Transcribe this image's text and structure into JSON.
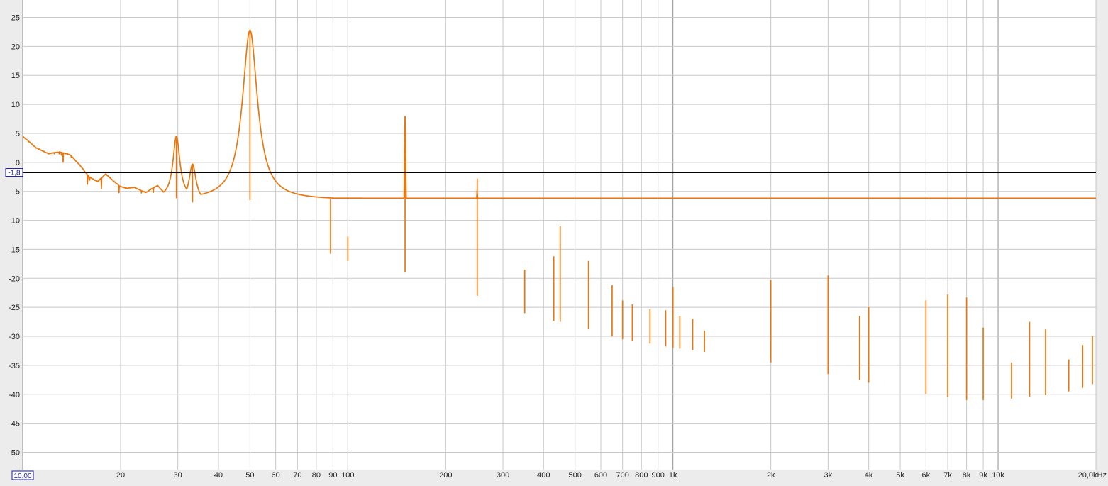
{
  "chart_data": {
    "type": "line",
    "x_scale": "log",
    "xlim": [
      10,
      20000
    ],
    "ylim": [
      -53,
      28
    ],
    "grid": true,
    "x_ticks": [
      {
        "value": 10,
        "label": "10,00",
        "boxed": true
      },
      {
        "value": 20,
        "label": "20"
      },
      {
        "value": 30,
        "label": "30"
      },
      {
        "value": 40,
        "label": "40"
      },
      {
        "value": 50,
        "label": "50"
      },
      {
        "value": 60,
        "label": "60"
      },
      {
        "value": 70,
        "label": "70"
      },
      {
        "value": 80,
        "label": "80"
      },
      {
        "value": 90,
        "label": "90"
      },
      {
        "value": 100,
        "label": "100"
      },
      {
        "value": 200,
        "label": "200"
      },
      {
        "value": 300,
        "label": "300"
      },
      {
        "value": 400,
        "label": "400"
      },
      {
        "value": 500,
        "label": "500"
      },
      {
        "value": 600,
        "label": "600"
      },
      {
        "value": 700,
        "label": "700"
      },
      {
        "value": 800,
        "label": "800"
      },
      {
        "value": 900,
        "label": "900"
      },
      {
        "value": 1000,
        "label": "1k"
      },
      {
        "value": 2000,
        "label": "2k"
      },
      {
        "value": 3000,
        "label": "3k"
      },
      {
        "value": 4000,
        "label": "4k"
      },
      {
        "value": 5000,
        "label": "5k"
      },
      {
        "value": 6000,
        "label": "6k"
      },
      {
        "value": 7000,
        "label": "7k"
      },
      {
        "value": 8000,
        "label": "8k"
      },
      {
        "value": 9000,
        "label": "9k"
      },
      {
        "value": 10000,
        "label": "10k"
      },
      {
        "value": 20000,
        "label": "20,0kHz"
      }
    ],
    "y_ticks": [
      {
        "value": 25,
        "label": "25"
      },
      {
        "value": 20,
        "label": "20"
      },
      {
        "value": 15,
        "label": "15"
      },
      {
        "value": 10,
        "label": "10"
      },
      {
        "value": 5,
        "label": "5"
      },
      {
        "value": 0,
        "label": "0"
      },
      {
        "value": -5,
        "label": "-5"
      },
      {
        "value": -10,
        "label": "-10"
      },
      {
        "value": -15,
        "label": "-15"
      },
      {
        "value": -20,
        "label": "-20"
      },
      {
        "value": -25,
        "label": "-25"
      },
      {
        "value": -30,
        "label": "-30"
      },
      {
        "value": -35,
        "label": "-35"
      },
      {
        "value": -40,
        "label": "-40"
      },
      {
        "value": -45,
        "label": "-45"
      },
      {
        "value": -50,
        "label": "-50"
      }
    ],
    "reference_line": {
      "value": -1.8,
      "label": "-1,8"
    },
    "colors": {
      "background": "#ffffff",
      "grid": "#c8c8c8",
      "grid_decade": "#909090",
      "trace": "#e8780e",
      "reference": "#000000",
      "tick_text": "#222222",
      "marker_text": "#1a1aa6"
    },
    "series": [
      {
        "noise_amplitude": 1.6,
        "floor": [
          [
            10,
            4.5
          ],
          [
            11,
            2.5
          ],
          [
            12,
            1.5
          ],
          [
            13,
            1.8
          ],
          [
            14,
            1.3
          ],
          [
            15,
            -0.5
          ],
          [
            16,
            -2.5
          ],
          [
            17,
            -3.3
          ],
          [
            18,
            -2.0
          ],
          [
            19,
            -3.2
          ],
          [
            20,
            -4.2
          ],
          [
            21,
            -4.5
          ],
          [
            22,
            -4.3
          ],
          [
            23,
            -4.8
          ],
          [
            24,
            -5.2
          ],
          [
            25,
            -4.5
          ],
          [
            26,
            -4.0
          ],
          [
            27,
            -5.0
          ],
          [
            28,
            -6.0
          ],
          [
            29,
            -6.6
          ],
          [
            30,
            -6.0
          ],
          [
            31,
            -5.1
          ],
          [
            32,
            -6.2
          ],
          [
            33,
            -7.1
          ],
          [
            34,
            -6.5
          ],
          [
            35,
            -6.2
          ],
          [
            36,
            -6.8
          ],
          [
            37,
            -7.5
          ],
          [
            37.5,
            -7.2
          ],
          [
            38,
            -7.3
          ],
          [
            39,
            -7.2
          ],
          [
            40,
            -8.5
          ],
          [
            41,
            -8.0
          ],
          [
            42,
            -8.5
          ],
          [
            43,
            -9.0
          ],
          [
            44,
            -8.5
          ],
          [
            45,
            -9.3
          ],
          [
            46,
            -8.5
          ],
          [
            47,
            -8.2
          ],
          [
            48,
            -7.5
          ],
          [
            49,
            -7.8
          ],
          [
            50,
            -6.5
          ],
          [
            52,
            -5.0
          ],
          [
            54,
            -3.5
          ],
          [
            56,
            -8.5
          ],
          [
            58,
            -10.0
          ],
          [
            60,
            -11.0
          ],
          [
            62,
            -12.0
          ],
          [
            65,
            -11.0
          ],
          [
            68,
            -13.0
          ],
          [
            70,
            -14.0
          ],
          [
            72,
            -13.5
          ],
          [
            75,
            -14.0
          ],
          [
            80,
            -15.0
          ],
          [
            85,
            -15.2
          ],
          [
            90,
            -16.0
          ],
          [
            95,
            -16.5
          ],
          [
            100,
            -17.0
          ],
          [
            110,
            -17.8
          ],
          [
            120,
            -18.5
          ],
          [
            130,
            -19.0
          ],
          [
            140,
            -19.0
          ],
          [
            150,
            -19.0
          ],
          [
            160,
            -19.8
          ],
          [
            180,
            -20.5
          ],
          [
            200,
            -21.5
          ],
          [
            230,
            -22.5
          ],
          [
            250,
            -23.0
          ],
          [
            300,
            -24.5
          ],
          [
            350,
            -26.0
          ],
          [
            400,
            -27.0
          ],
          [
            450,
            -27.5
          ],
          [
            500,
            -28.0
          ],
          [
            600,
            -29.5
          ],
          [
            700,
            -30.5
          ],
          [
            800,
            -31.0
          ],
          [
            900,
            -31.5
          ],
          [
            1000,
            -32.0
          ],
          [
            1200,
            -32.5
          ],
          [
            1500,
            -33.5
          ],
          [
            2000,
            -34.5
          ],
          [
            2500,
            -35.5
          ],
          [
            3000,
            -36.5
          ],
          [
            3500,
            -37.0
          ],
          [
            4000,
            -38.0
          ],
          [
            5000,
            -39.0
          ],
          [
            6000,
            -40.0
          ],
          [
            7000,
            -40.5
          ],
          [
            8000,
            -41.0
          ],
          [
            9000,
            -41.0
          ],
          [
            10000,
            -41.0
          ],
          [
            12000,
            -40.5
          ],
          [
            15000,
            -40.0
          ],
          [
            18000,
            -39.0
          ],
          [
            20000,
            -38.0
          ]
        ],
        "peaks": [
          {
            "x": 29.7,
            "y": 4.5,
            "width": 0.013
          },
          {
            "x": 33.3,
            "y": -0.3,
            "width": 0.013
          },
          {
            "x": 50,
            "y": 22.8,
            "width": 0.028
          },
          {
            "x": 88.5,
            "y": -6.3,
            "width": 0.0025
          },
          {
            "x": 100,
            "y": -12.8,
            "width": 0.003
          },
          {
            "x": 150,
            "y": 8.0,
            "width": 0.003
          },
          {
            "x": 250,
            "y": -2.8,
            "width": 0.0015
          },
          {
            "x": 350,
            "y": -18.5,
            "width": 0.0012
          },
          {
            "x": 430,
            "y": -16.2,
            "width": 0.0012
          },
          {
            "x": 450,
            "y": -11.0,
            "width": 0.0012
          },
          {
            "x": 550,
            "y": -17.0,
            "width": 0.0012
          },
          {
            "x": 650,
            "y": -21.2,
            "width": 0.001
          },
          {
            "x": 700,
            "y": -23.8,
            "width": 0.001
          },
          {
            "x": 750,
            "y": -24.5,
            "width": 0.001
          },
          {
            "x": 850,
            "y": -25.3,
            "width": 0.001
          },
          {
            "x": 950,
            "y": -25.5,
            "width": 0.001
          },
          {
            "x": 1000,
            "y": -21.5,
            "width": 0.001
          },
          {
            "x": 1050,
            "y": -26.5,
            "width": 0.001
          },
          {
            "x": 1150,
            "y": -27.0,
            "width": 0.001
          },
          {
            "x": 1250,
            "y": -29.0,
            "width": 0.001
          },
          {
            "x": 2000,
            "y": -20.3,
            "width": 0.0008
          },
          {
            "x": 3000,
            "y": -19.5,
            "width": 0.0008
          },
          {
            "x": 3750,
            "y": -26.5,
            "width": 0.0008
          },
          {
            "x": 4000,
            "y": -25.0,
            "width": 0.0008
          },
          {
            "x": 6000,
            "y": -23.8,
            "width": 0.0007
          },
          {
            "x": 7000,
            "y": -22.8,
            "width": 0.0007
          },
          {
            "x": 8000,
            "y": -23.3,
            "width": 0.0007
          },
          {
            "x": 9000,
            "y": -28.5,
            "width": 0.0007
          },
          {
            "x": 11000,
            "y": -34.5,
            "width": 0.0007
          },
          {
            "x": 12500,
            "y": -27.5,
            "width": 0.0007
          },
          {
            "x": 14000,
            "y": -28.8,
            "width": 0.0007
          },
          {
            "x": 16500,
            "y": -34.0,
            "width": 0.0007
          },
          {
            "x": 18200,
            "y": -31.5,
            "width": 0.0007
          },
          {
            "x": 19500,
            "y": -30.0,
            "width": 0.0007
          }
        ]
      }
    ]
  }
}
